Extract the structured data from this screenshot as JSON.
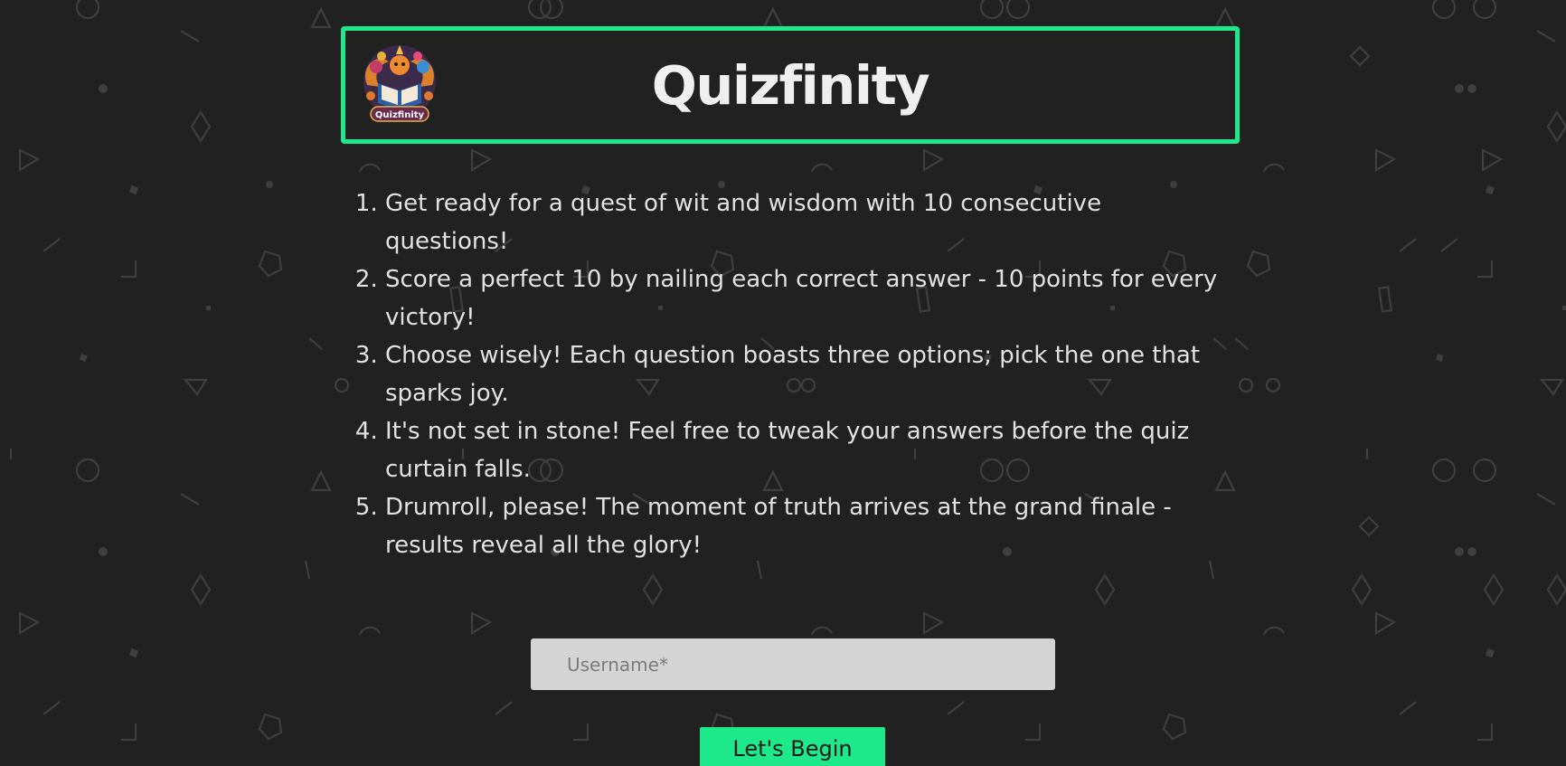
{
  "header": {
    "title": "Quizfinity",
    "logo_text": "Quizfinity"
  },
  "rules": [
    "Get ready for a quest of wit and wisdom with 10 consecutive questions!",
    "Score a perfect 10 by nailing each correct answer - 10 points for every victory!",
    "Choose wisely! Each question boasts three options; pick the one that sparks joy.",
    "It's not set in stone! Feel free to tweak your answers before the quiz curtain falls.",
    "Drumroll, please! The moment of truth arrives at the grand finale - results reveal all the glory!"
  ],
  "form": {
    "username_placeholder": "Username*",
    "username_value": "",
    "begin_label": "Let's Begin"
  },
  "colors": {
    "accent": "#1de98b",
    "background": "#212121",
    "input_bg": "#d4d4d4"
  }
}
